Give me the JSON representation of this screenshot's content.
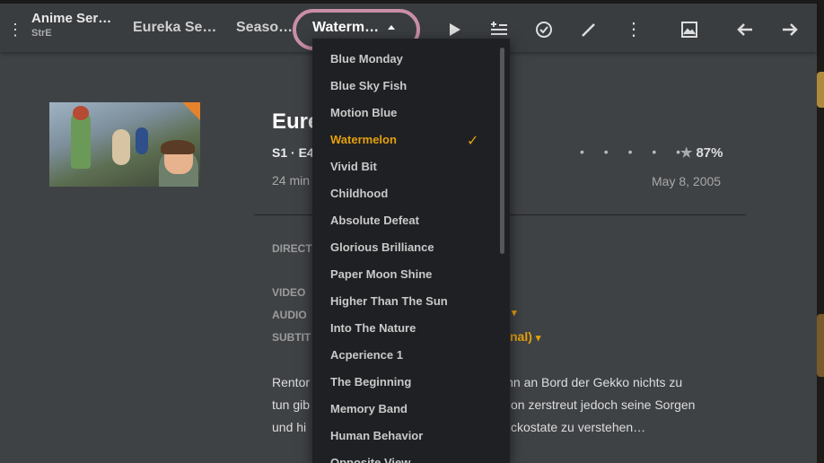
{
  "topbar": {
    "series_title": "Anime Ser…",
    "series_sub": "StrE",
    "show": "Eureka Se…",
    "season": "Seaso…",
    "episode": "Waterm…"
  },
  "episode": {
    "title": "Eure",
    "subtitle": "S1 · E4",
    "duration": "24 min",
    "rating_dots": "• • • • •",
    "rating": "87%",
    "air_date": "May 8, 2005"
  },
  "meta": {
    "director_label": "DIRECT",
    "video_label": "VIDEO",
    "audio_label": "AUDIO",
    "subtitles_label": "SUBTIT",
    "subtitles_value": "nal)"
  },
  "summary": {
    "line1_left": "Rentor",
    "line1_right": "ihn an Bord der Gekko nichts zu",
    "line2_left": "tun gib",
    "line2_right": "on zerstreut jedoch seine Sorgen",
    "line3_left": "und hi",
    "line3_right": "ckostate zu verstehen…"
  },
  "dropdown": {
    "items": [
      "Blue Monday",
      "Blue Sky Fish",
      "Motion Blue",
      "Watermelon",
      "Vivid Bit",
      "Childhood",
      "Absolute Defeat",
      "Glorious Brilliance",
      "Paper Moon Shine",
      "Higher Than The Sun",
      "Into The Nature",
      "Acperience 1",
      "The Beginning",
      "Memory Band",
      "Human Behavior",
      "Opposite View"
    ],
    "selected": "Watermelon"
  },
  "colors": {
    "accent": "#e5a00d",
    "highlight_ring": "#c98fa6"
  },
  "icons": {
    "play": "play-icon",
    "add_to_queue": "add-to-queue-icon",
    "mark_watched": "check-circle-icon",
    "edit": "pencil-icon",
    "more": "more-vertical-icon",
    "image": "image-icon",
    "previous": "arrow-left-icon",
    "next": "arrow-right-icon"
  }
}
